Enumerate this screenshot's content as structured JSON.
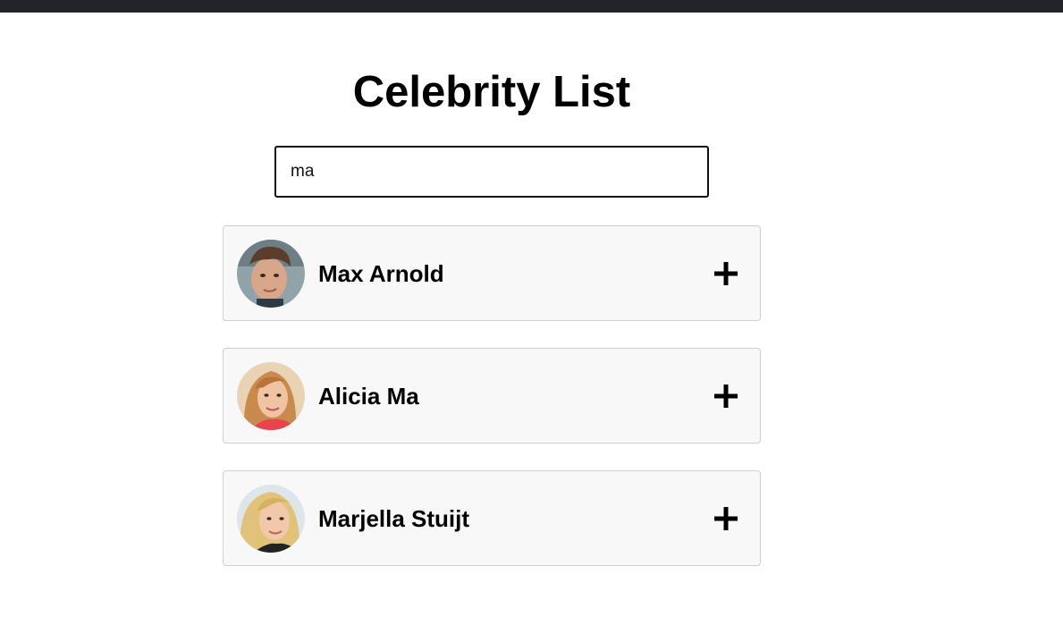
{
  "header": {
    "title": "Celebrity List"
  },
  "search": {
    "value": "ma",
    "placeholder": ""
  },
  "celebrities": [
    {
      "name": "Max Arnold",
      "avatar": "portrait-photo",
      "action_icon": "plus-icon"
    },
    {
      "name": "Alicia Ma",
      "avatar": "portrait-photo",
      "action_icon": "plus-icon"
    },
    {
      "name": "Marjella Stuijt",
      "avatar": "portrait-photo",
      "action_icon": "plus-icon"
    }
  ],
  "colors": {
    "top_bar": "#212529",
    "card_background": "#f8f8f8",
    "card_border": "#cfcfcf",
    "text": "#000000"
  }
}
